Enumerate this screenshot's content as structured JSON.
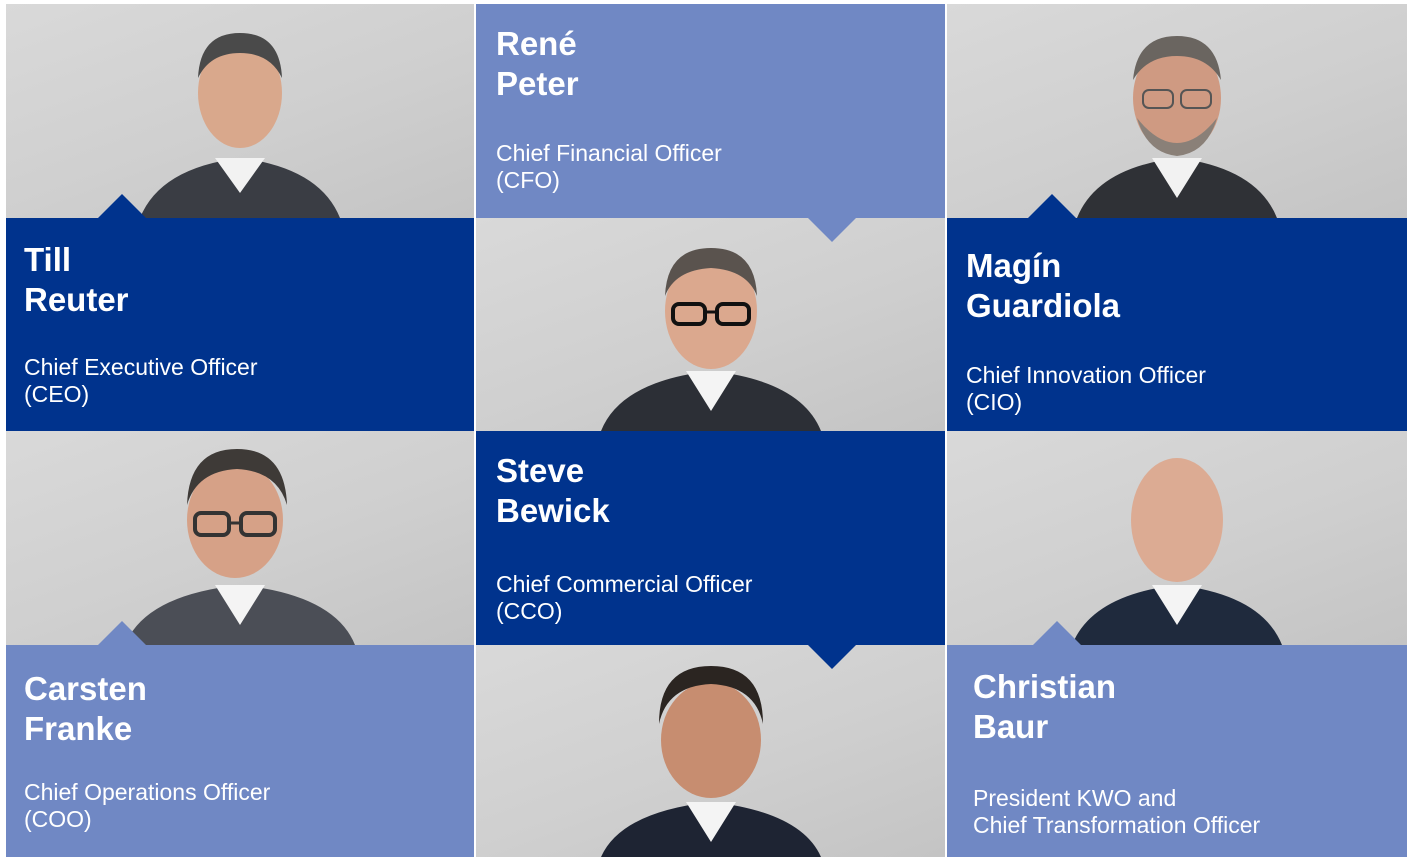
{
  "colors": {
    "dark_blue": "#00338d",
    "light_blue": "#7088c4",
    "photo_bg": "#d4d4d4"
  },
  "members": [
    {
      "first": "Till",
      "last": "Reuter",
      "role_line1": "Chief Executive Officer",
      "role_line2": "(CEO)"
    },
    {
      "first": "René",
      "last": "Peter",
      "role_line1": "Chief Financial Officer",
      "role_line2": "(CFO)"
    },
    {
      "first": "Magín",
      "last": "Guardiola",
      "role_line1": "Chief Innovation Officer",
      "role_line2": "(CIO)"
    },
    {
      "first": "Steve",
      "last": "Bewick",
      "role_line1": "Chief Commercial Officer",
      "role_line2": "(CCO)"
    },
    {
      "first": "Carsten",
      "last": "Franke",
      "role_line1": "Chief Operations Officer",
      "role_line2": "(COO)"
    },
    {
      "first": "Christian",
      "last": "Baur",
      "role_line1": "President KWO and",
      "role_line2": "Chief Transformation Officer"
    }
  ]
}
